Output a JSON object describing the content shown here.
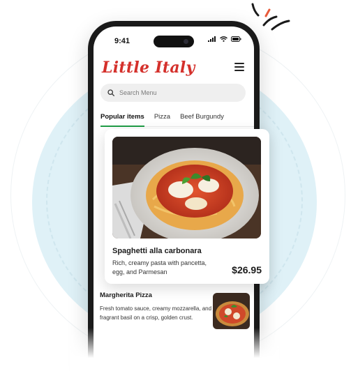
{
  "status_bar": {
    "time": "9:41"
  },
  "brand": {
    "name": "Little Italy",
    "color": "#d4302b"
  },
  "header": {
    "menu_icon": "hamburger-menu-icon"
  },
  "search": {
    "placeholder": "Search Menu",
    "value": "",
    "icon": "search-icon"
  },
  "tabs": [
    {
      "label": "Popular items",
      "active": true
    },
    {
      "label": "Pizza",
      "active": false
    },
    {
      "label": "Beef Burgundy",
      "active": false
    }
  ],
  "accent_color": "#1f9d46",
  "featured": {
    "title": "Spaghetti alla carbonara",
    "description": "Rich, creamy pasta with pancetta, egg, and Parmesan",
    "price": "$26.95"
  },
  "items": [
    {
      "title": "Margherita Pizza",
      "description": "Fresh tomato sauce, creamy mozzarella, and fragrant basil on a crisp, golden crust."
    }
  ]
}
